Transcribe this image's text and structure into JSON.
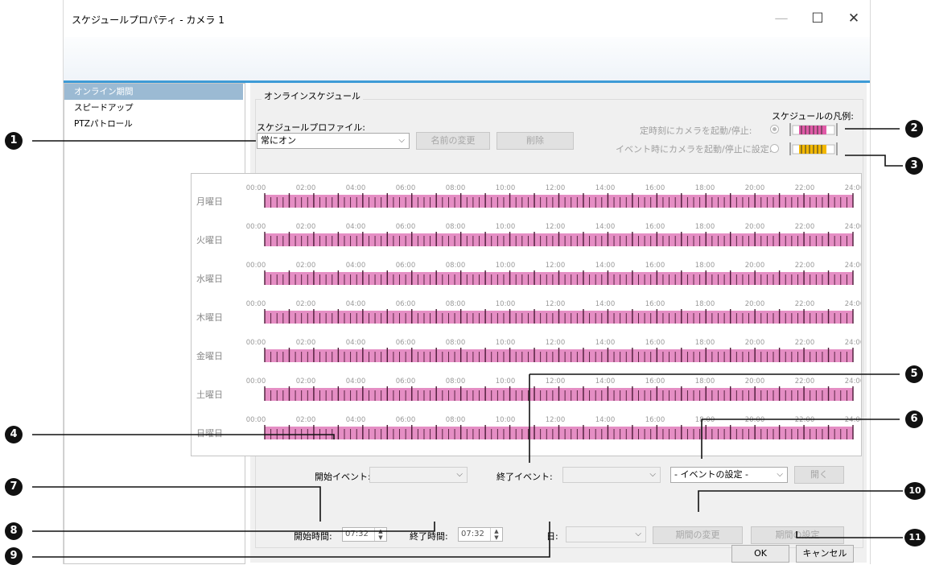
{
  "window": {
    "title": "スケジュールプロパティ - カメラ 1",
    "controls": {
      "minimize": "—",
      "maximize": "☐",
      "close": "✕"
    }
  },
  "sidebar": {
    "items": [
      {
        "label": "オンライン期間",
        "selected": true
      },
      {
        "label": "スピードアップ",
        "selected": false
      },
      {
        "label": "PTZパトロール",
        "selected": false
      }
    ]
  },
  "group_title": "オンラインスケジュール",
  "profile": {
    "label": "スケジュールプロファイル:",
    "value": "常にオン",
    "rename_button": "名前の変更",
    "delete_button": "削除"
  },
  "legend": {
    "title": "スケジュールの凡例:",
    "timed_label": "定時刻にカメラを起動/停止:",
    "event_label": "イベント時にカメラを起動/停止に設定:",
    "timed_color": "#e05aa7",
    "event_color": "#f3b800"
  },
  "schedule": {
    "days": [
      "月曜日",
      "火曜日",
      "水曜日",
      "木曜日",
      "金曜日",
      "土曜日",
      "日曜日"
    ],
    "time_ticks": [
      "00:00",
      "02:00",
      "04:00",
      "06:00",
      "08:00",
      "10:00",
      "12:00",
      "14:00",
      "16:00",
      "18:00",
      "20:00",
      "22:00",
      "24:00"
    ],
    "bar_color": "#e58ec4"
  },
  "events": {
    "start_label": "開始イベント:",
    "end_label": "終了イベント:",
    "event_setting_value": "- イベントの設定 -",
    "open_button": "開く"
  },
  "period": {
    "start_time_label": "開始時間:",
    "start_time_value": "07:32",
    "end_time_label": "終了時間:",
    "end_time_value": "07:32",
    "day_label": "日:",
    "change_button": "期間の変更",
    "set_button": "期間の設定"
  },
  "footer": {
    "ok_button": "OK",
    "cancel_button": "キャンセル"
  },
  "callouts": [
    "1",
    "2",
    "3",
    "4",
    "5",
    "6",
    "7",
    "8",
    "9",
    "10",
    "11"
  ]
}
